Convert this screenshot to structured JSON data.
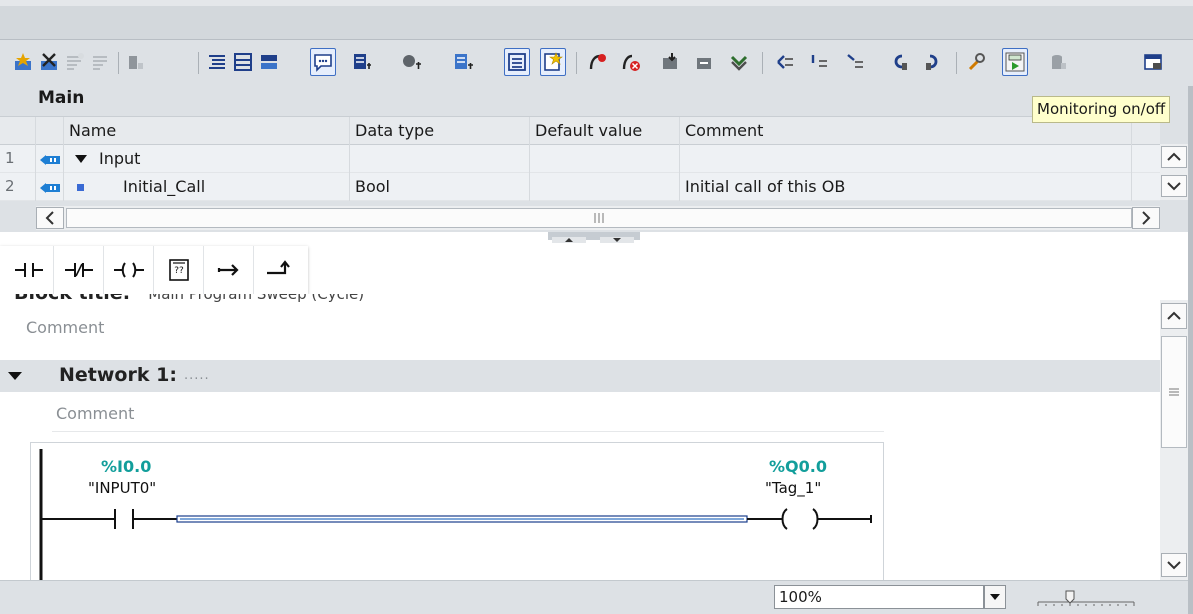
{
  "tooltip": {
    "text": "Monitoring on/off"
  },
  "interface": {
    "title": "Main",
    "columns": [
      "Name",
      "Data type",
      "Default value",
      "Comment"
    ],
    "rows": [
      {
        "num": "1",
        "name": "Input",
        "data_type": "",
        "default_value": "",
        "comment": ""
      },
      {
        "num": "2",
        "name": "Initial_Call",
        "data_type": "Bool",
        "default_value": "",
        "comment": "Initial call of this OB"
      }
    ]
  },
  "instructions": [
    {
      "name": "normally-open-contact"
    },
    {
      "name": "normally-closed-contact"
    },
    {
      "name": "output-coil"
    },
    {
      "name": "empty-box"
    },
    {
      "name": "open-branch"
    },
    {
      "name": "close-branch"
    }
  ],
  "editor": {
    "block_title_label": "Block title:",
    "block_title_value": "Main Program Sweep (Cycle)",
    "block_comment": "Comment",
    "network": {
      "title": "Network 1:",
      "dots": ".....",
      "comment": "Comment",
      "contact": {
        "address": "%I0.0",
        "tag": "\"INPUT0\""
      },
      "coil": {
        "address": "%Q0.0",
        "tag": "\"Tag_1\""
      }
    }
  },
  "status": {
    "zoom": "100%"
  },
  "colors": {
    "address": "#129e9b",
    "power_flow": "#1a3e8c",
    "accent": "#3f6fc4"
  }
}
